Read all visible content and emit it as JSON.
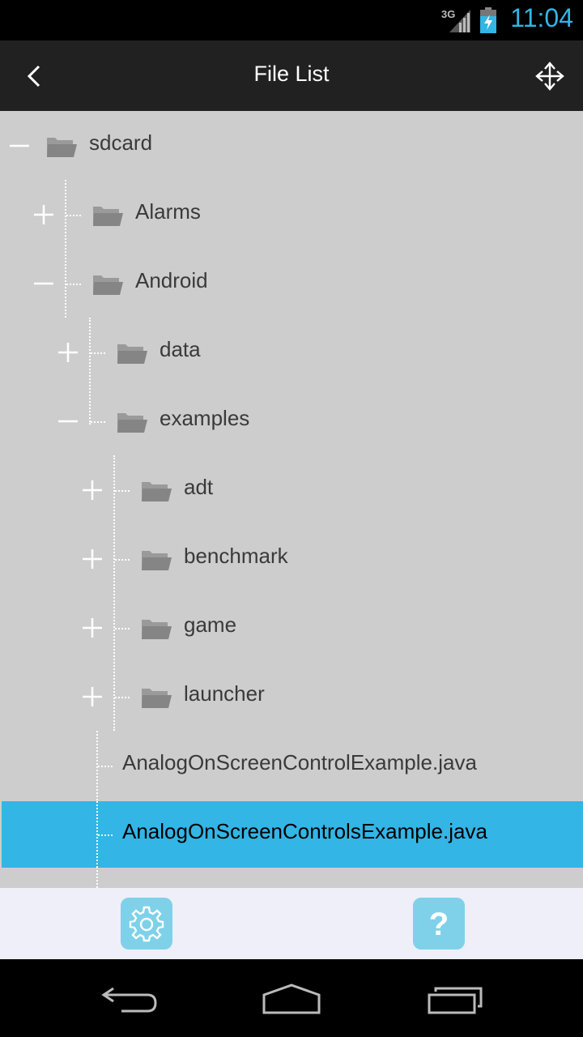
{
  "status_bar": {
    "network": "3G",
    "time": "11:04"
  },
  "action_bar": {
    "title": "File List"
  },
  "tree": {
    "items": [
      {
        "label": "sdcard",
        "type": "folder",
        "toggle": "collapse"
      },
      {
        "label": "Alarms",
        "type": "folder",
        "toggle": "expand"
      },
      {
        "label": "Android",
        "type": "folder",
        "toggle": "collapse"
      },
      {
        "label": "data",
        "type": "folder",
        "toggle": "expand"
      },
      {
        "label": "examples",
        "type": "folder",
        "toggle": "collapse"
      },
      {
        "label": "adt",
        "type": "folder",
        "toggle": "expand"
      },
      {
        "label": "benchmark",
        "type": "folder",
        "toggle": "expand"
      },
      {
        "label": "game",
        "type": "folder",
        "toggle": "expand"
      },
      {
        "label": "launcher",
        "type": "folder",
        "toggle": "expand"
      },
      {
        "label": "AnalogOnScreenControlExample.java",
        "type": "file"
      },
      {
        "label": "AnalogOnScreenControlsExample.java",
        "type": "file",
        "selected": true
      }
    ]
  },
  "colors": {
    "accent": "#33b5e5",
    "tree_bg": "#cdcdcd",
    "toolbar_button": "#7fd1ea"
  },
  "toolbar": {
    "settings_icon": "gear-icon",
    "help_icon": "question-icon"
  }
}
